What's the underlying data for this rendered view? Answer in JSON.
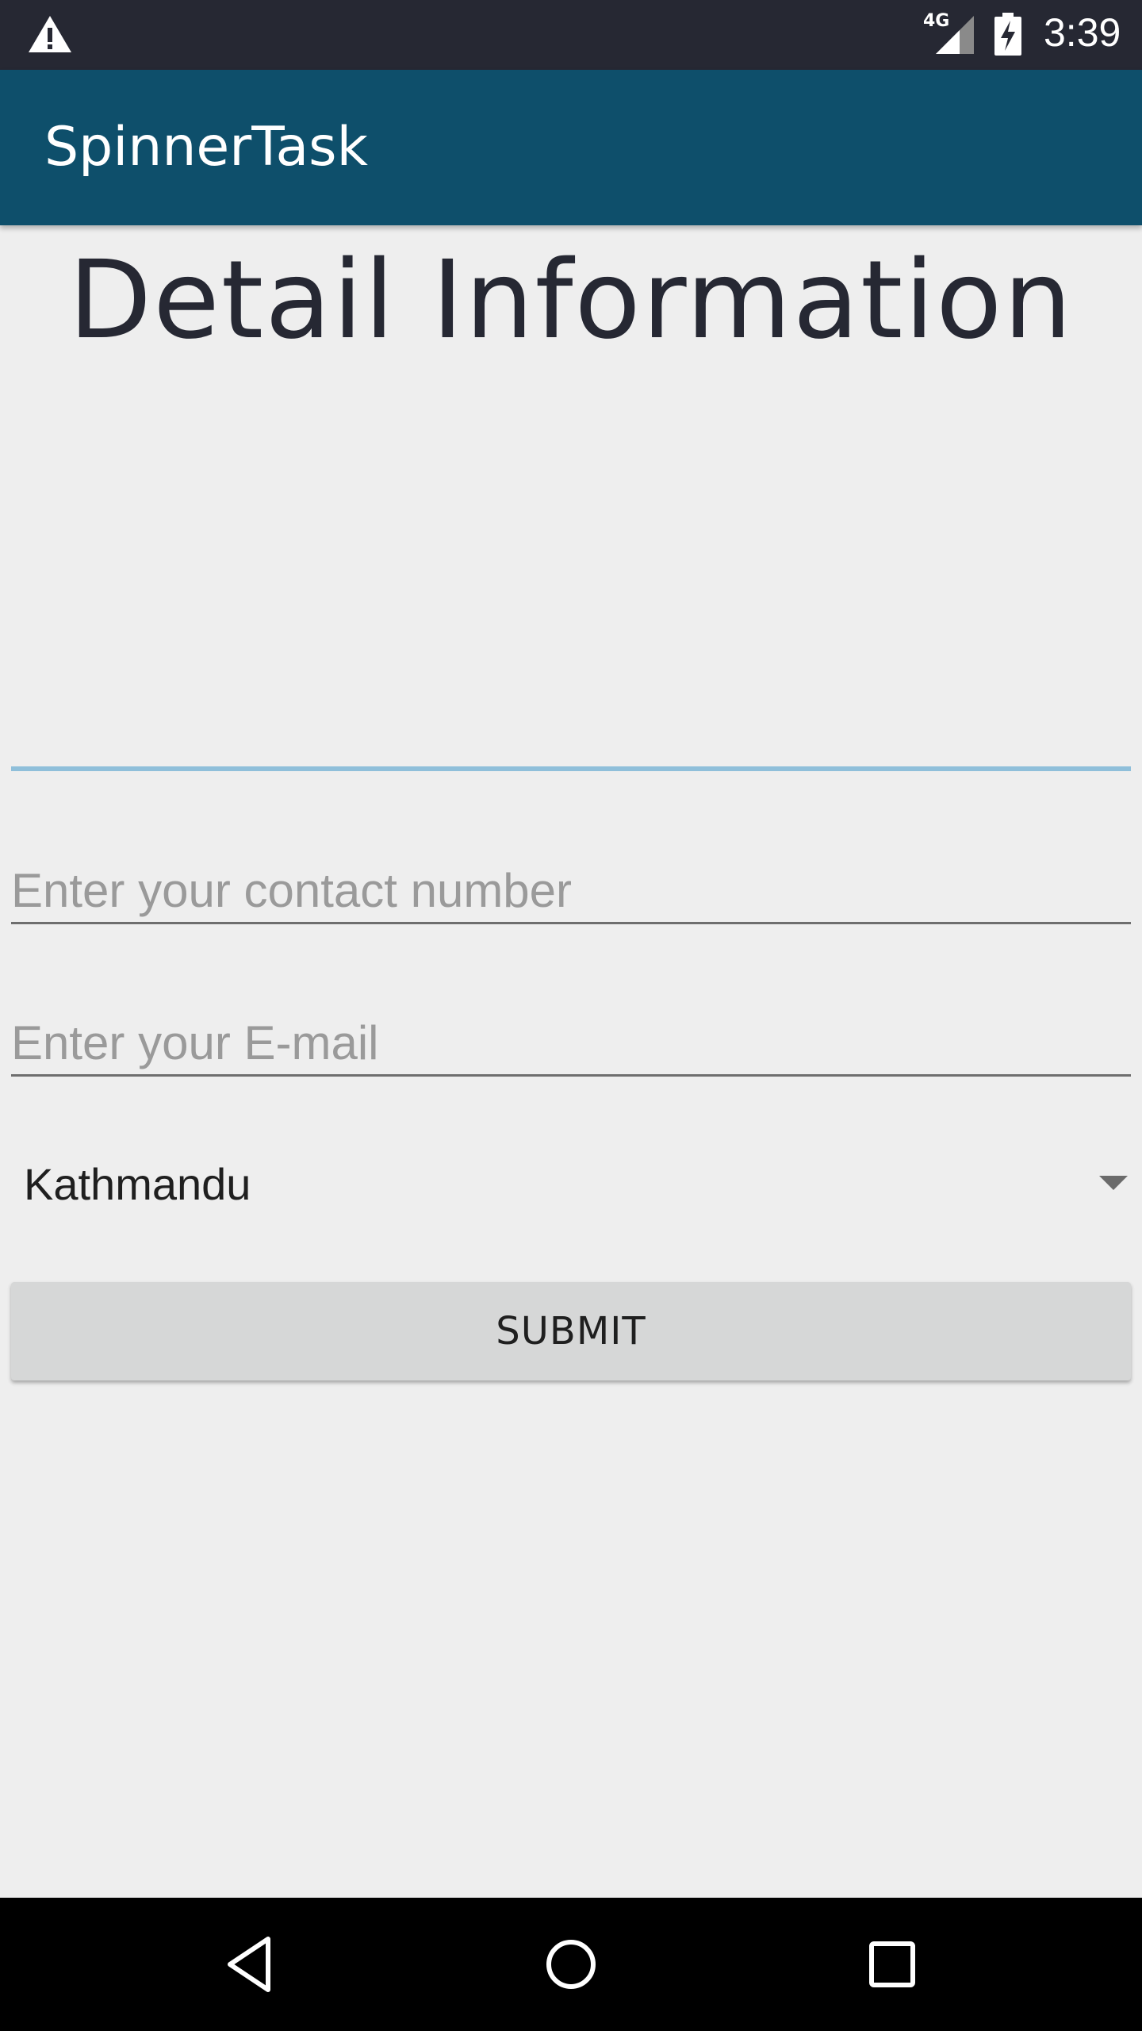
{
  "status_bar": {
    "time": "3:39",
    "network": "4G",
    "icons": [
      "warning-icon",
      "signal-icon",
      "battery-charging-icon"
    ]
  },
  "app_bar": {
    "title": "SpinnerTask"
  },
  "main": {
    "heading": "Detail Information",
    "contact_field": {
      "value": "",
      "placeholder": "Enter your contact number"
    },
    "email_field": {
      "value": "",
      "placeholder": "Enter your E-mail"
    },
    "city_spinner": {
      "selected": "Kathmandu"
    },
    "submit_label": "SUBMIT"
  },
  "nav_bar": {
    "icons": [
      "back-icon",
      "home-icon",
      "recent-apps-icon"
    ]
  },
  "colors": {
    "status_bar": "#262833",
    "app_bar": "#0e4f6b",
    "background": "#eeeeee",
    "focus_accent": "#8fbfda",
    "button": "#d6d7d7"
  }
}
